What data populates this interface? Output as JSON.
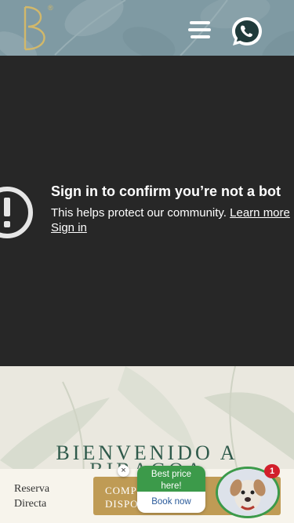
{
  "header": {
    "logo_letter": "B",
    "logo_mark": "®",
    "menu_icon": "hamburger-icon",
    "whatsapp_icon": "whatsapp-icon",
    "colors": {
      "background": "#7f9aa3",
      "logo": "#d2b86a"
    }
  },
  "video": {
    "title": "Sign in to confirm you’re not a bot",
    "body": "This helps protect our community.",
    "learn_more": "Learn more",
    "sign_in": "Sign in",
    "icon": "alert-icon",
    "background": "#272727"
  },
  "hero": {
    "title_line1": "BIENVENIDO A",
    "title_line2": "BIBAGOA",
    "color": "#2f5a4b"
  },
  "booking": {
    "reserva_line1": "Reserva",
    "reserva_line2": "Directa",
    "compare_line1": "COMPROBAR",
    "compare_line2": "DISPONIBILIDAD",
    "button_color": "#bf9b55"
  },
  "chat": {
    "best_price_line1": "Best price",
    "best_price_line2": "here!",
    "book_now": "Book now",
    "close": "×",
    "badge_count": "1",
    "accent": "#3c9a4a"
  }
}
